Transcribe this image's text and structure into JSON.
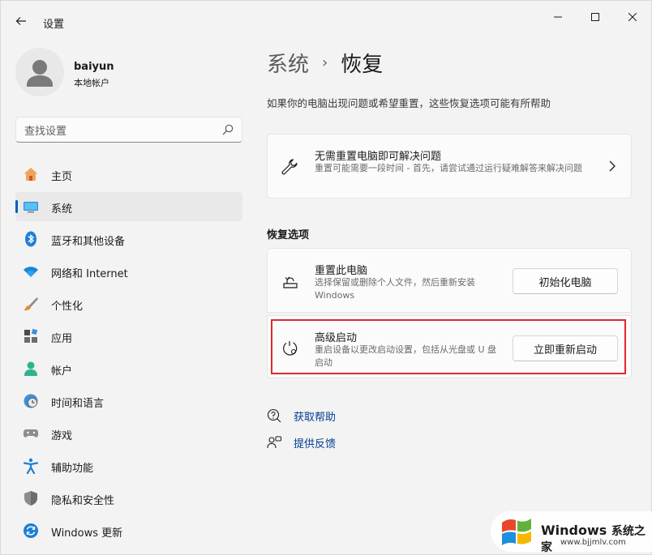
{
  "window": {
    "title": "设置"
  },
  "profile": {
    "name": "baiyun",
    "account_type": "本地帐户"
  },
  "search": {
    "placeholder": "查找设置"
  },
  "sidebar": {
    "items": [
      {
        "label": "主页",
        "icon": "home-icon"
      },
      {
        "label": "系统",
        "icon": "system-icon",
        "active": true
      },
      {
        "label": "蓝牙和其他设备",
        "icon": "bluetooth-icon"
      },
      {
        "label": "网络和 Internet",
        "icon": "wifi-icon"
      },
      {
        "label": "个性化",
        "icon": "brush-icon"
      },
      {
        "label": "应用",
        "icon": "apps-icon"
      },
      {
        "label": "帐户",
        "icon": "account-icon"
      },
      {
        "label": "时间和语言",
        "icon": "globe-clock-icon"
      },
      {
        "label": "游戏",
        "icon": "gamepad-icon"
      },
      {
        "label": "辅助功能",
        "icon": "accessibility-icon"
      },
      {
        "label": "隐私和安全性",
        "icon": "shield-icon"
      },
      {
        "label": "Windows 更新",
        "icon": "update-icon"
      }
    ]
  },
  "breadcrumb": {
    "parent": "系统",
    "separator": "›",
    "current": "恢复"
  },
  "page": {
    "description": "如果你的电脑出现问题或希望重置，这些恢复选项可能有所帮助"
  },
  "fix_card": {
    "title": "无需重置电脑即可解决问题",
    "description": "重置可能需要一段时间 - 首先，请尝试通过运行疑难解答来解决问题",
    "icon": "wrench-icon"
  },
  "recovery_options": {
    "heading": "恢复选项",
    "reset": {
      "title": "重置此电脑",
      "description": "选择保留或删除个人文件，然后重新安装 Windows",
      "button": "初始化电脑",
      "icon": "reset-pc-icon"
    },
    "advanced": {
      "title": "高级启动",
      "description": "重启设备以更改启动设置，包括从光盘或 U 盘启动",
      "button": "立即重新启动",
      "icon": "advanced-startup-icon"
    }
  },
  "links": {
    "help": "获取帮助",
    "feedback": "提供反馈"
  },
  "watermark": {
    "brand": "Windows",
    "brand_cn": "系统之家",
    "url": "www.bjjmlv.com"
  },
  "colors": {
    "accent": "#005fb8",
    "highlight_border": "#e0282d",
    "link": "#003e92"
  }
}
